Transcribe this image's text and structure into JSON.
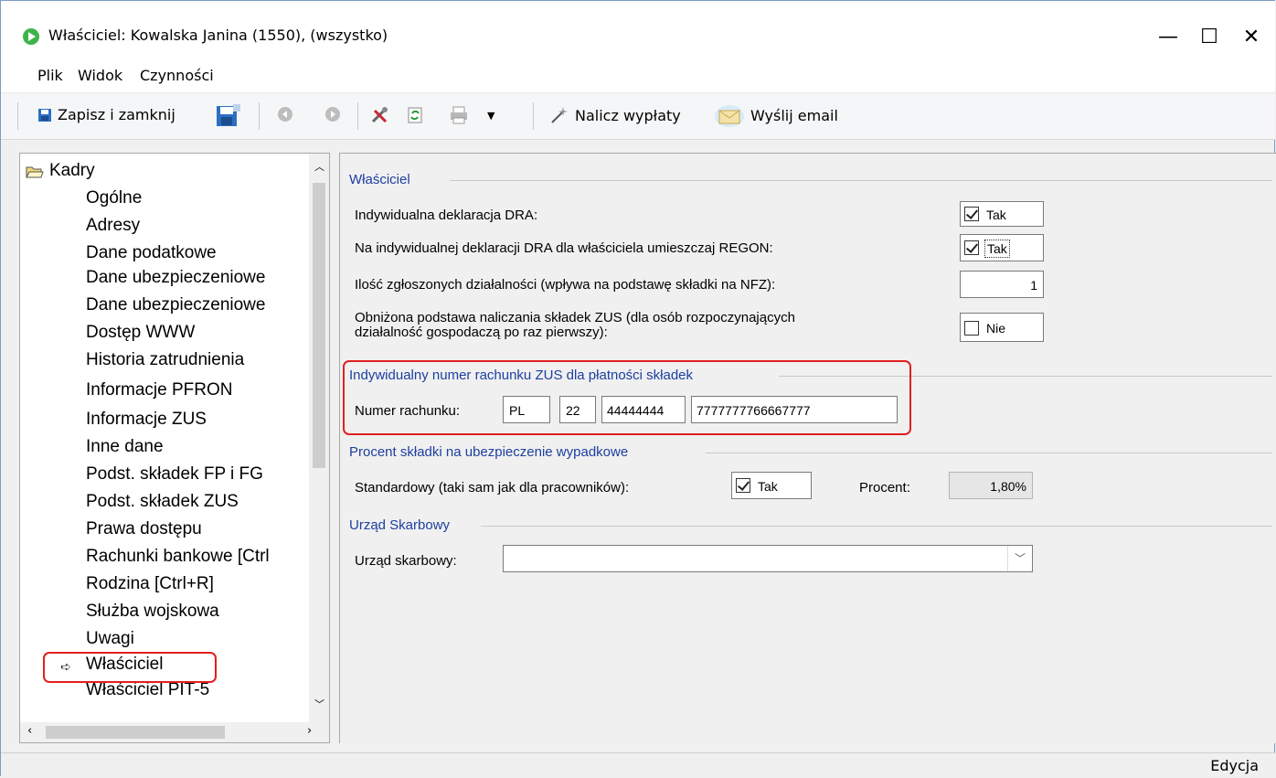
{
  "window": {
    "title": "Właściciel: Kowalska Janina (1550), (wszystko)",
    "minimize": "—",
    "maximize": "☐",
    "close": "✕"
  },
  "menu": [
    "Plik",
    "Widok",
    "Czynności"
  ],
  "toolbar": {
    "save_close": "Zapisz i zamknij",
    "calc_payouts": "Nalicz wypłaty",
    "send_email": "Wyślij email"
  },
  "tree": {
    "root": "Kadry",
    "items": [
      "Ogólne",
      "Adresy",
      "Dane podatkowe",
      "Dane ubezpieczeniowe",
      "Dane ubezpieczeniowe",
      "Dostęp WWW",
      "Historia zatrudnienia",
      "Informacje PFRON",
      "Informacje ZUS",
      "Inne dane",
      "Podst. składek FP i FG",
      "Podst. składek ZUS",
      "Prawa dostępu",
      "Rachunki bankowe [Ctrl",
      "Rodzina [Ctrl+R]",
      "Służba wojskowa",
      "Uwagi",
      "Właściciel",
      "Właściciel PIT-5"
    ],
    "selected": "Właściciel"
  },
  "owner": {
    "group_title": "Właściciel",
    "dra_label": "Indywidualna deklaracja DRA:",
    "dra_value": "Tak",
    "regon_label": "Na indywidualnej deklaracji DRA dla właściciela umieszczaj REGON:",
    "regon_value": "Tak",
    "count_label": "Ilość zgłoszonych działalności (wpływa na podstawę składki na NFZ):",
    "count_value": "1",
    "reduced_label_1": "Obniżona podstawa naliczania składek ZUS (dla osób rozpoczynających",
    "reduced_label_2": "działalność gospodaczą po raz pierwszy):",
    "reduced_value": "Nie"
  },
  "zus_account": {
    "group_title": "Indywidualny numer rachunku ZUS dla płatności składek",
    "label": "Numer rachunku:",
    "country": "PL",
    "check": "22",
    "part1": "44444444",
    "part2": "7777777766667777"
  },
  "accident": {
    "group_title": "Procent składki na ubezpieczenie wypadkowe",
    "standard_label": "Standardowy (taki sam jak dla pracowników):",
    "standard_value": "Tak",
    "percent_label": "Procent:",
    "percent_value": "1,80%"
  },
  "tax_office": {
    "group_title": "Urząd Skarbowy",
    "label": "Urząd skarbowy:",
    "value": ""
  },
  "status": {
    "mode": "Edycja"
  }
}
